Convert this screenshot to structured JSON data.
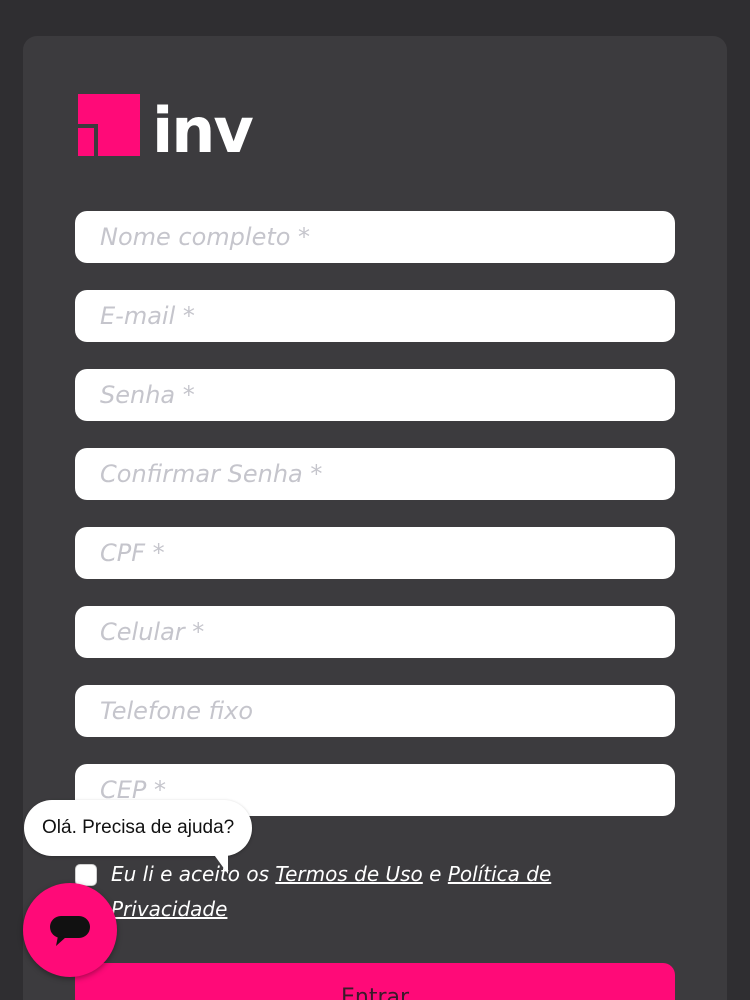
{
  "brand": {
    "name": "inv",
    "accent": "#ff0a78"
  },
  "form": {
    "fields": [
      {
        "placeholder": "Nome completo *",
        "value": ""
      },
      {
        "placeholder": "E-mail *",
        "value": ""
      },
      {
        "placeholder": "Senha *",
        "value": ""
      },
      {
        "placeholder": "Confirmar Senha *",
        "value": ""
      },
      {
        "placeholder": "CPF *",
        "value": ""
      },
      {
        "placeholder": "Celular *",
        "value": ""
      },
      {
        "placeholder": "Telefone fixo",
        "value": ""
      },
      {
        "placeholder": "CEP *",
        "value": ""
      }
    ],
    "terms": {
      "checked": false,
      "prefix": "Eu li e aceito os",
      "terms_link": "Termos de Uso",
      "connector": "e",
      "privacy_link_line1": "Política de",
      "privacy_link_line2": "Privacidade"
    },
    "submit_label": "Entrar"
  },
  "chat": {
    "greeting": "Olá. Precisa de ajuda?",
    "icon": "chat-bubble-icon"
  }
}
